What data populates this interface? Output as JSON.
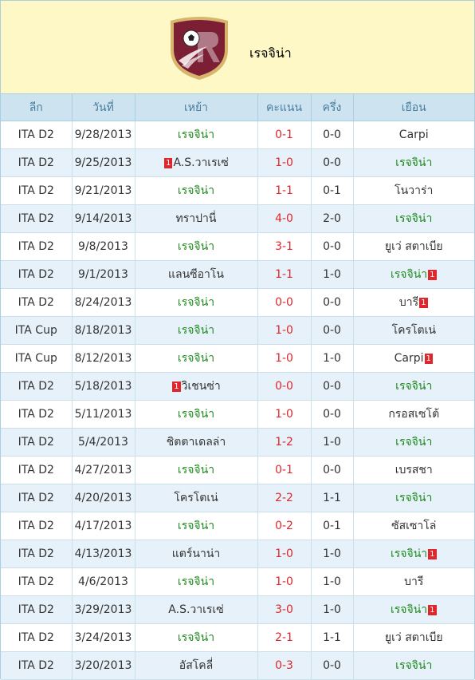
{
  "team": {
    "name": "เรจจิน่า"
  },
  "table": {
    "headers": {
      "league": "ลีก",
      "date": "วันที่",
      "home": "เหย้า",
      "score": "คะแนน",
      "half": "ครึ่ง",
      "away": "เยือน"
    },
    "rows": [
      {
        "league": "ITA D2",
        "date": "9/28/2013",
        "home": "เรจจิน่า",
        "home_green": true,
        "home_card": "",
        "score": "0-1",
        "half": "0-0",
        "away": "Carpi",
        "away_green": false,
        "away_card": ""
      },
      {
        "league": "ITA D2",
        "date": "9/25/2013",
        "home": "A.S.วาเรเซ่",
        "home_green": false,
        "home_card": "1",
        "score": "1-0",
        "half": "0-0",
        "away": "เรจจิน่า",
        "away_green": true,
        "away_card": ""
      },
      {
        "league": "ITA D2",
        "date": "9/21/2013",
        "home": "เรจจิน่า",
        "home_green": true,
        "home_card": "",
        "score": "1-1",
        "half": "0-1",
        "away": "โนวาร่า",
        "away_green": false,
        "away_card": ""
      },
      {
        "league": "ITA D2",
        "date": "9/14/2013",
        "home": "ทราปานี่",
        "home_green": false,
        "home_card": "",
        "score": "4-0",
        "half": "2-0",
        "away": "เรจจิน่า",
        "away_green": true,
        "away_card": ""
      },
      {
        "league": "ITA D2",
        "date": "9/8/2013",
        "home": "เรจจิน่า",
        "home_green": true,
        "home_card": "",
        "score": "3-1",
        "half": "0-0",
        "away": "ยูเว่ สตาเบีย",
        "away_green": false,
        "away_card": ""
      },
      {
        "league": "ITA D2",
        "date": "9/1/2013",
        "home": "แลนซีอาโน",
        "home_green": false,
        "home_card": "",
        "score": "1-1",
        "half": "1-0",
        "away": "เรจจิน่า",
        "away_green": true,
        "away_card": "1"
      },
      {
        "league": "ITA D2",
        "date": "8/24/2013",
        "home": "เรจจิน่า",
        "home_green": true,
        "home_card": "",
        "score": "0-0",
        "half": "0-0",
        "away": "บารี",
        "away_green": false,
        "away_card": "1"
      },
      {
        "league": "ITA Cup",
        "date": "8/18/2013",
        "home": "เรจจิน่า",
        "home_green": true,
        "home_card": "",
        "score": "1-0",
        "half": "0-0",
        "away": "โครโตเน่",
        "away_green": false,
        "away_card": ""
      },
      {
        "league": "ITA Cup",
        "date": "8/12/2013",
        "home": "เรจจิน่า",
        "home_green": true,
        "home_card": "",
        "score": "1-0",
        "half": "1-0",
        "away": "Carpi",
        "away_green": false,
        "away_card": "1"
      },
      {
        "league": "ITA D2",
        "date": "5/18/2013",
        "home": "วิเชนซ่า",
        "home_green": false,
        "home_card": "1",
        "score": "0-0",
        "half": "0-0",
        "away": "เรจจิน่า",
        "away_green": true,
        "away_card": ""
      },
      {
        "league": "ITA D2",
        "date": "5/11/2013",
        "home": "เรจจิน่า",
        "home_green": true,
        "home_card": "",
        "score": "1-0",
        "half": "0-0",
        "away": "กรอสเซโต้",
        "away_green": false,
        "away_card": ""
      },
      {
        "league": "ITA D2",
        "date": "5/4/2013",
        "home": "ชิตตาเดลล่า",
        "home_green": false,
        "home_card": "",
        "score": "1-2",
        "half": "1-0",
        "away": "เรจจิน่า",
        "away_green": true,
        "away_card": ""
      },
      {
        "league": "ITA D2",
        "date": "4/27/2013",
        "home": "เรจจิน่า",
        "home_green": true,
        "home_card": "",
        "score": "0-1",
        "half": "0-0",
        "away": "เบรสชา",
        "away_green": false,
        "away_card": ""
      },
      {
        "league": "ITA D2",
        "date": "4/20/2013",
        "home": "โครโตเน่",
        "home_green": false,
        "home_card": "",
        "score": "2-2",
        "half": "1-1",
        "away": "เรจจิน่า",
        "away_green": true,
        "away_card": ""
      },
      {
        "league": "ITA D2",
        "date": "4/17/2013",
        "home": "เรจจิน่า",
        "home_green": true,
        "home_card": "",
        "score": "0-2",
        "half": "0-1",
        "away": "ซัสเซาโล่",
        "away_green": false,
        "away_card": ""
      },
      {
        "league": "ITA D2",
        "date": "4/13/2013",
        "home": "แตร์นาน่า",
        "home_green": false,
        "home_card": "",
        "score": "1-0",
        "half": "1-0",
        "away": "เรจจิน่า",
        "away_green": true,
        "away_card": "1"
      },
      {
        "league": "ITA D2",
        "date": "4/6/2013",
        "home": "เรจจิน่า",
        "home_green": true,
        "home_card": "",
        "score": "1-0",
        "half": "1-0",
        "away": "บารี",
        "away_green": false,
        "away_card": ""
      },
      {
        "league": "ITA D2",
        "date": "3/29/2013",
        "home": "A.S.วาเรเซ่",
        "home_green": false,
        "home_card": "",
        "score": "3-0",
        "half": "1-0",
        "away": "เรจจิน่า",
        "away_green": true,
        "away_card": "1"
      },
      {
        "league": "ITA D2",
        "date": "3/24/2013",
        "home": "เรจจิน่า",
        "home_green": true,
        "home_card": "",
        "score": "2-1",
        "half": "1-1",
        "away": "ยูเว่ สตาเบีย",
        "away_green": false,
        "away_card": ""
      },
      {
        "league": "ITA D2",
        "date": "3/20/2013",
        "home": "อัสโคลี่",
        "home_green": false,
        "home_card": "",
        "score": "0-3",
        "half": "0-0",
        "away": "เรจจิน่า",
        "away_green": true,
        "away_card": ""
      }
    ]
  }
}
